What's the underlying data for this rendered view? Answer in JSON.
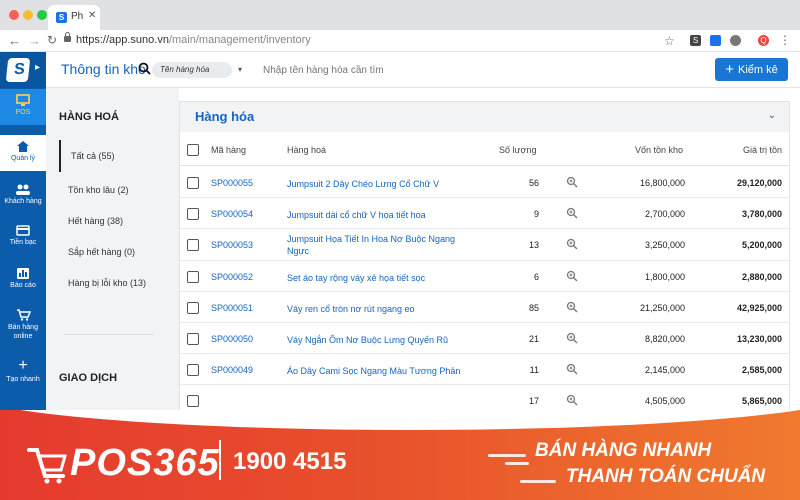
{
  "browser": {
    "tab_title": "Ph",
    "url_host": "https://app.suno.vn",
    "url_path": "/main/management/inventory",
    "profile_initial": "Q"
  },
  "header": {
    "title": "Thông tin kho",
    "search_select": "Tên hàng hóa",
    "search_placeholder": "Nhập tên hàng hóa cần tìm",
    "kiemke_label": "Kiểm kê"
  },
  "sidebar": {
    "items": [
      {
        "label": "POS",
        "icon": "monitor-icon"
      },
      {
        "label": "Quản lý",
        "icon": "home-icon"
      },
      {
        "label": "Khách hàng",
        "icon": "users-icon"
      },
      {
        "label": "Tiền bạc",
        "icon": "card-icon"
      },
      {
        "label": "Báo cáo",
        "icon": "chart-icon"
      },
      {
        "label": "Bán hàng online",
        "icon": "cart-icon"
      },
      {
        "label": "Tạo nhanh",
        "icon": "plus-icon"
      }
    ]
  },
  "categories": {
    "heading": "HÀNG HOÁ",
    "items": [
      "Tất cả (55)",
      "Tồn kho lâu (2)",
      "Hết hàng (38)",
      "Sắp hết hàng (0)",
      "Hàng bị lỗi kho (13)"
    ],
    "heading2": "GIAO DỊCH"
  },
  "panel": {
    "title": "Hàng hóa",
    "columns": [
      "Mã hàng",
      "Hàng hoá",
      "Số lượng",
      "Vốn tồn kho",
      "Giá trị tồn"
    ],
    "rows": [
      {
        "code": "SP000055",
        "name": "Jumpsuit 2 Dây Chéo Lưng Cổ Chữ V",
        "qty": "56",
        "von": "16,800,000",
        "gia": "29,120,000"
      },
      {
        "code": "SP000054",
        "name": "Jumpsuit dài cổ chữ V họa tiết hoa",
        "qty": "9",
        "von": "2,700,000",
        "gia": "3,780,000"
      },
      {
        "code": "SP000053",
        "name": "Jumpsuit Họa Tiết In Hoa Nơ Buộc Ngang Ngực",
        "qty": "13",
        "von": "3,250,000",
        "gia": "5,200,000"
      },
      {
        "code": "SP000052",
        "name": "Set áo tay rộng váy xẻ họa tiết sọc",
        "qty": "6",
        "von": "1,800,000",
        "gia": "2,880,000"
      },
      {
        "code": "SP000051",
        "name": "Váy ren cổ tròn nơ rút ngang eo",
        "qty": "85",
        "von": "21,250,000",
        "gia": "42,925,000"
      },
      {
        "code": "SP000050",
        "name": "Váy Ngắn Ôm Nơ Buộc Lưng Quyến Rũ",
        "qty": "21",
        "von": "8,820,000",
        "gia": "13,230,000"
      },
      {
        "code": "SP000049",
        "name": "Áo Dây Cami Sọc Ngang Màu Tương Phản",
        "qty": "11",
        "von": "2,145,000",
        "gia": "2,585,000"
      },
      {
        "code": "",
        "name": "",
        "qty": "17",
        "von": "4,505,000",
        "gia": "5,865,000"
      }
    ]
  },
  "banner": {
    "brand": "POS365",
    "phone": "1900 4515",
    "slogan1": "BÁN HÀNG NHANH",
    "slogan2": "THANH TOÁN CHUẨN"
  },
  "colors": {
    "primary": "#1976d2",
    "sidebar": "#0b5cab",
    "banner": "#e84f2c"
  }
}
